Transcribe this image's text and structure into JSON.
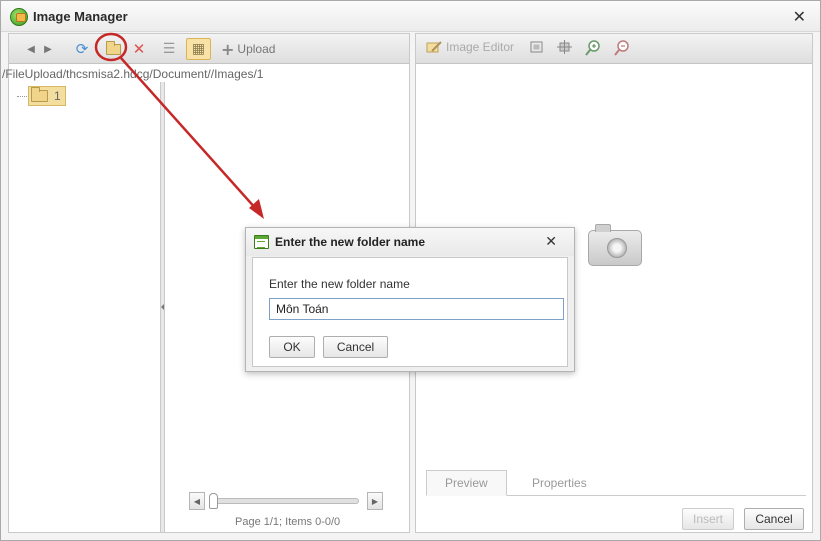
{
  "window": {
    "title": "Image Manager",
    "close_glyph": "✕"
  },
  "toolbar": {
    "items": [
      {
        "icon": "arrow-left-icon",
        "glyph": "◀"
      },
      {
        "icon": "arrow-right-icon",
        "glyph": "▶"
      },
      {
        "icon": "refresh-icon",
        "glyph": "⟳"
      },
      {
        "icon": "new-folder-icon"
      },
      {
        "icon": "delete-icon",
        "glyph": "✕"
      },
      {
        "icon": "list-view-icon",
        "glyph": "☰"
      },
      {
        "icon": "thumbnail-view-icon",
        "glyph": "▦"
      }
    ],
    "upload_label": "Upload",
    "upload_glyph": "+"
  },
  "path": "/FileUpload/thcsmisa2.hdcg/Document//Images/1",
  "tree": {
    "items": [
      {
        "label": "1"
      }
    ]
  },
  "pager": {
    "info": "Page 1/1; Items 0-0/0",
    "prev": "◀",
    "next": "▶"
  },
  "right_toolbar": {
    "image_editor_label": "Image Editor",
    "icons": [
      "editor-icon",
      "fit-icon",
      "actual-size-icon",
      "zoom-in-icon",
      "zoom-out-icon"
    ]
  },
  "tabs": [
    {
      "label": "Preview"
    },
    {
      "label": "Properties"
    }
  ],
  "buttons": {
    "insert": "Insert",
    "cancel": "Cancel"
  },
  "dialog": {
    "title": "Enter the new folder name",
    "close_glyph": "✕",
    "label": "Enter the new folder name",
    "input_value": "Môn Toán",
    "ok": "OK",
    "cancel": "Cancel"
  },
  "colors": {
    "annotation": "#c62828",
    "active_bg": "#f8e2a8",
    "input_border": "#7ea1c9"
  }
}
